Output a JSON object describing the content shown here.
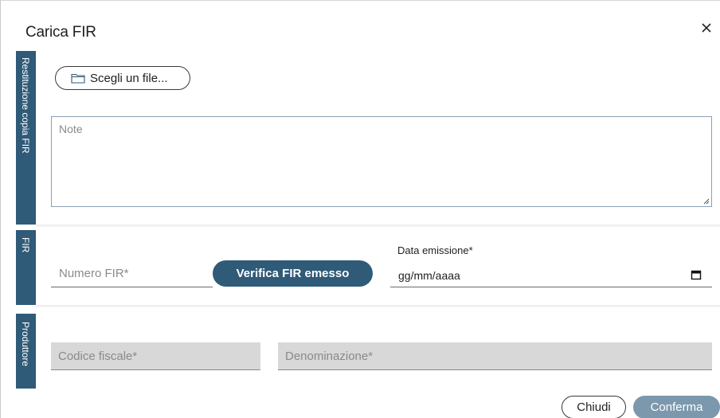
{
  "dialog": {
    "title": "Carica FIR"
  },
  "sections": {
    "restituzione": {
      "tab_label": "Restituzione copia FIR"
    },
    "fir": {
      "tab_label": "FIR"
    },
    "produttore": {
      "tab_label": "Produttore"
    }
  },
  "upload": {
    "button_label": "Scegli un file...",
    "icon": "folder-icon"
  },
  "note": {
    "placeholder": "Note"
  },
  "fir": {
    "numero_placeholder": "Numero FIR*",
    "verify_label": "Verifica FIR emesso",
    "date_label": "Data emissione*",
    "date_value": "gg/mm/aaaa"
  },
  "produttore": {
    "codice_fiscale_placeholder": "Codice fiscale*",
    "denominazione_placeholder": "Denominazione*"
  },
  "footer": {
    "close_label": "Chiudi",
    "confirm_label": "Conferma"
  },
  "colors": {
    "primary": "#2f5a78",
    "primary_disabled": "#7b98ad",
    "disabled_field": "#d8d8d8"
  }
}
